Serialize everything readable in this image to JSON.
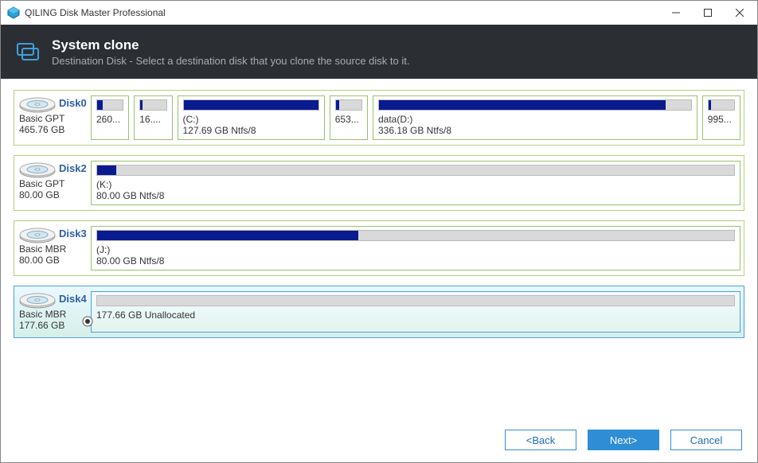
{
  "window": {
    "title": "QILING Disk Master Professional"
  },
  "header": {
    "title": "System clone",
    "subtitle": "Destination Disk - Select a destination disk that you clone the source disk to it."
  },
  "disks": [
    {
      "name": "Disk0",
      "type": "Basic GPT",
      "size": "465.76 GB",
      "selected": false,
      "partitions": [
        {
          "flex": 4,
          "fill": 22,
          "label1": "",
          "label2": "260..."
        },
        {
          "flex": 4,
          "fill": 10,
          "label1": "",
          "label2": "16...."
        },
        {
          "flex": 20,
          "fill": 100,
          "label1": "(C:)",
          "label2": "127.69 GB Ntfs/8"
        },
        {
          "flex": 4,
          "fill": 12,
          "label1": "",
          "label2": "653..."
        },
        {
          "flex": 46,
          "fill": 92,
          "label1": "data(D:)",
          "label2": "336.18 GB Ntfs/8"
        },
        {
          "flex": 4,
          "fill": 10,
          "label1": "",
          "label2": "995..."
        }
      ]
    },
    {
      "name": "Disk2",
      "type": "Basic GPT",
      "size": "80.00 GB",
      "selected": false,
      "partitions": [
        {
          "flex": 100,
          "fill": 3,
          "label1": "(K:)",
          "label2": "80.00 GB Ntfs/8"
        }
      ]
    },
    {
      "name": "Disk3",
      "type": "Basic MBR",
      "size": "80.00 GB",
      "selected": false,
      "partitions": [
        {
          "flex": 100,
          "fill": 41,
          "label1": "(J:)",
          "label2": "80.00 GB Ntfs/8"
        }
      ]
    },
    {
      "name": "Disk4",
      "type": "Basic MBR",
      "size": "177.66 GB",
      "selected": true,
      "partitions": [
        {
          "flex": 100,
          "fill": 0,
          "label1": "",
          "label2": "177.66 GB Unallocated"
        }
      ]
    }
  ],
  "buttons": {
    "back": "<Back",
    "next": "Next>",
    "cancel": "Cancel"
  }
}
